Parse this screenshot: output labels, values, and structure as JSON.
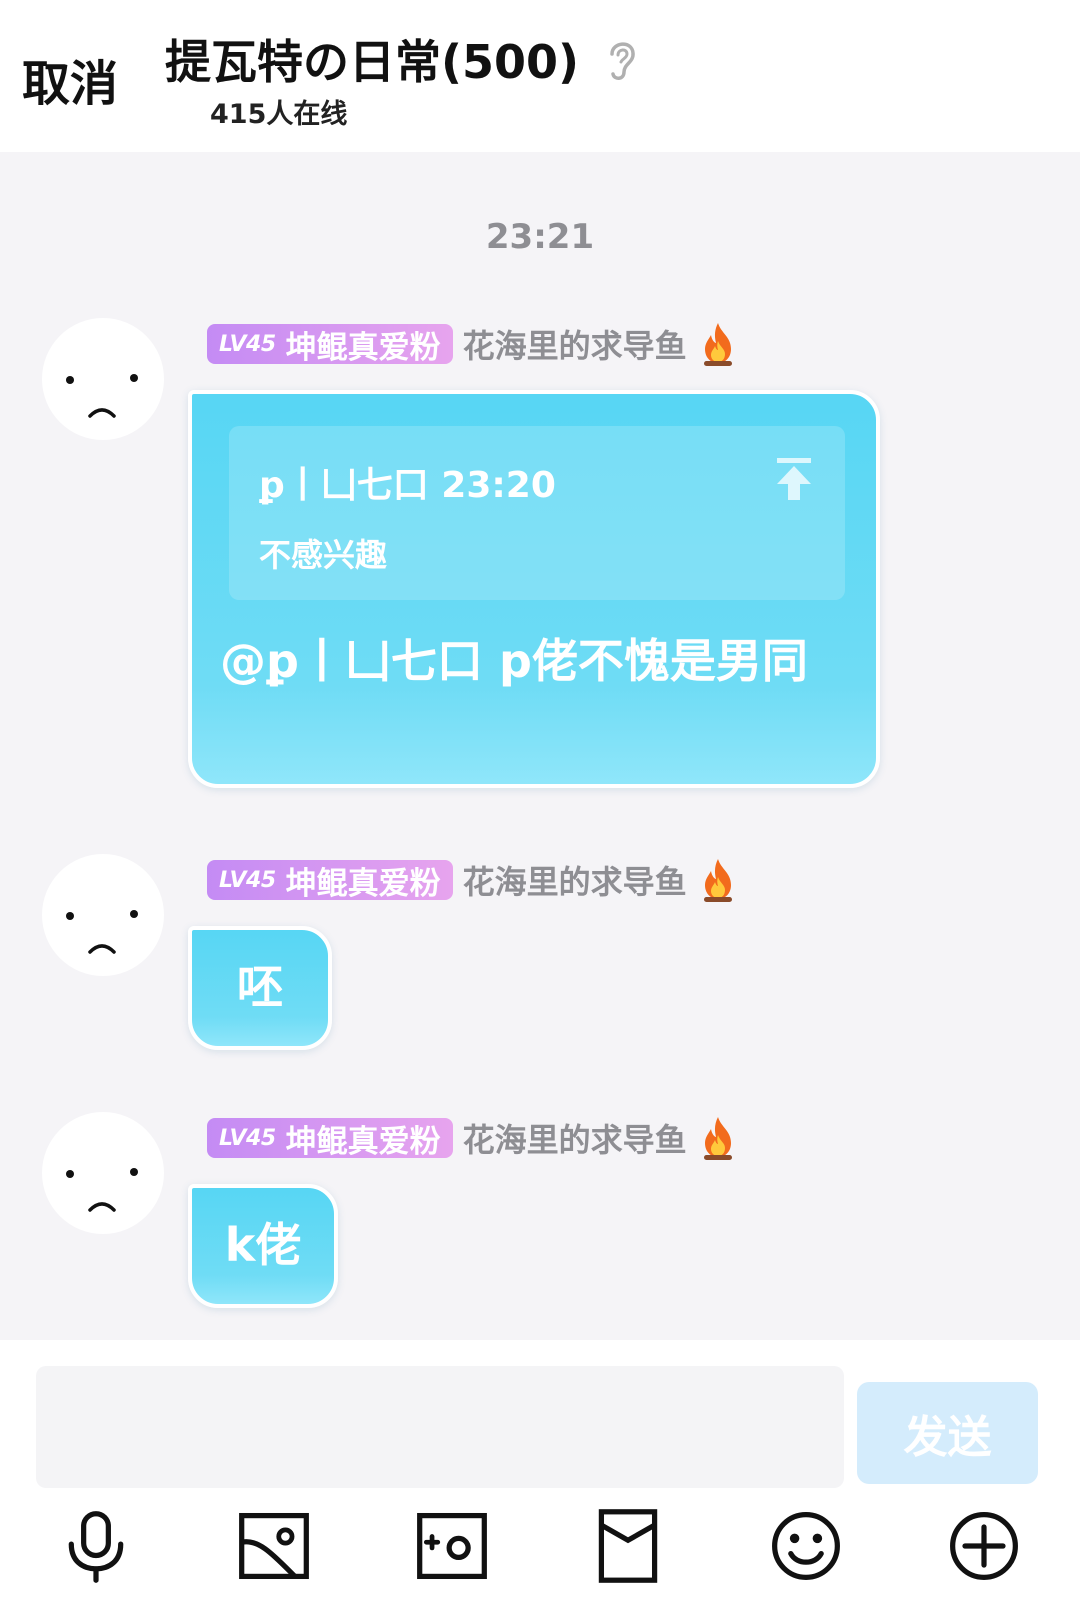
{
  "header": {
    "cancel_label": "取消",
    "title": "提瓦特の日常(500)",
    "online_text": "415人在线"
  },
  "time_label": "23:21",
  "messages": [
    {
      "level": "LV45",
      "badge": "坤鲲真爱粉",
      "nickname": "花海里的求导鱼",
      "quote": {
        "author_time": "ꝑ丨凵七口 23:20",
        "text": "不感兴趣"
      },
      "text": "@ꝑ丨凵七口 p佬不愧是男同"
    },
    {
      "level": "LV45",
      "badge": "坤鲲真爱粉",
      "nickname": "花海里的求导鱼",
      "text": "呸"
    },
    {
      "level": "LV45",
      "badge": "坤鲲真爱粉",
      "nickname": "花海里的求导鱼",
      "text": "k佬"
    }
  ],
  "input": {
    "value": "",
    "placeholder": ""
  },
  "send_label": "发送",
  "toolbar_icons": [
    "microphone-icon",
    "image-icon",
    "camera-icon",
    "red-packet-icon",
    "emoji-icon",
    "plus-icon"
  ],
  "colors": {
    "bubble": "#5ed8f5",
    "badge_gradient_start": "#c48bf4",
    "badge_gradient_end": "#e7a4ee",
    "nickname": "#8e8e93",
    "send_button_disabled": "#d4ecfc",
    "background": "#f5f4f7"
  }
}
